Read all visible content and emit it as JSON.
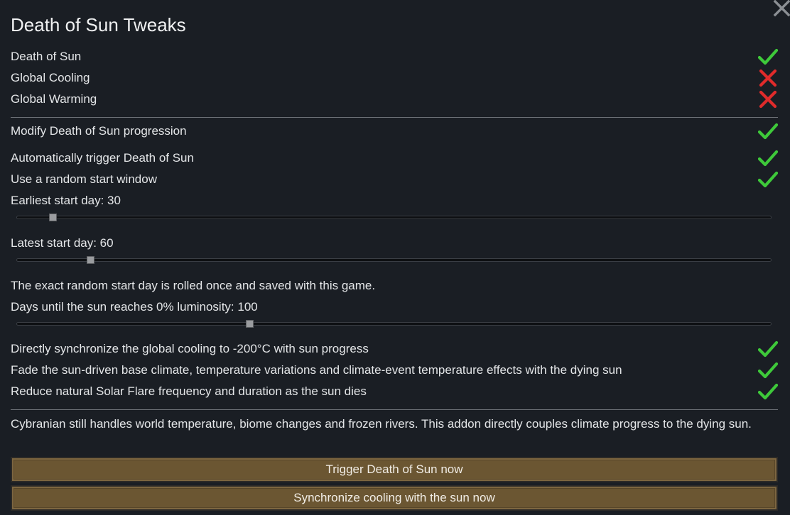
{
  "dialog": {
    "title": "Death of Sun Tweaks"
  },
  "toggles": [
    {
      "label": "Death of Sun",
      "state": "on"
    },
    {
      "label": "Global Cooling",
      "state": "off"
    },
    {
      "label": "Global Warming",
      "state": "off"
    },
    {
      "label": "Modify Death of Sun progression",
      "state": "on"
    },
    {
      "label": "Automatically trigger Death of Sun",
      "state": "on"
    },
    {
      "label": "Use a random start window",
      "state": "on"
    }
  ],
  "sliders": {
    "earliest": {
      "label": "Earliest start day: 30",
      "value": 30,
      "fraction": 0.048
    },
    "latest": {
      "label": "Latest start day: 60",
      "value": 60,
      "fraction": 0.098
    },
    "days_to_zero": {
      "label": "Days until the sun reaches 0% luminosity: 100",
      "value": 100,
      "fraction": 0.309
    }
  },
  "note_random_day": "The exact random start day is rolled once and saved with this game.",
  "sync_toggles": [
    {
      "label": "Directly synchronize the global cooling to -200°C with sun progress",
      "state": "on"
    },
    {
      "label": "Fade the sun-driven base climate, temperature variations and climate-event temperature effects with the dying sun",
      "state": "on"
    },
    {
      "label": "Reduce natural Solar Flare frequency and duration as the sun dies",
      "state": "on"
    }
  ],
  "footer_note": "Cybranian still handles world temperature, biome changes and frozen rivers. This addon directly couples climate progress to the dying sun.",
  "buttons": {
    "trigger": "Trigger Death of Sun now",
    "synchronize": "Synchronize cooling with the sun now"
  },
  "colors": {
    "check_on": "#3ec93a",
    "check_off": "#e02b2b",
    "button_bg": "#6b5632",
    "background": "#1a1e24"
  },
  "icons": {
    "on": "checkmark-icon",
    "off": "cross-icon",
    "close": "close-icon"
  }
}
